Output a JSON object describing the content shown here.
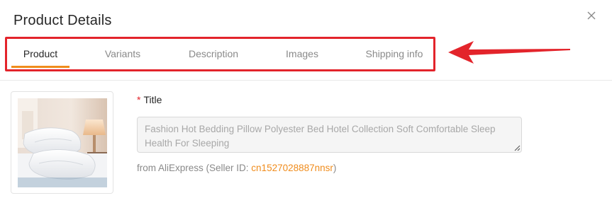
{
  "dialog": {
    "title": "Product Details",
    "close_icon": "close-icon"
  },
  "tabs": [
    {
      "label": "Product",
      "active": true
    },
    {
      "label": "Variants",
      "active": false
    },
    {
      "label": "Description",
      "active": false
    },
    {
      "label": "Images",
      "active": false
    },
    {
      "label": "Shipping info",
      "active": false
    }
  ],
  "annotation": {
    "highlight_color": "#e3242b",
    "arrow_icon": "arrow-left-icon"
  },
  "product": {
    "image_icon": "pillow-photo",
    "title_label": "Title",
    "required_mark": "*",
    "title_value": "Fashion Hot Bedding Pillow Polyester Bed Hotel Collection Soft Comfortable Sleep Health For Sleeping",
    "source_prefix": "from AliExpress (Seller ID: ",
    "seller_id": "cn1527028887nnsr",
    "source_suffix": ")"
  },
  "colors": {
    "accent": "#f08c1c",
    "highlight": "#e3242b"
  }
}
